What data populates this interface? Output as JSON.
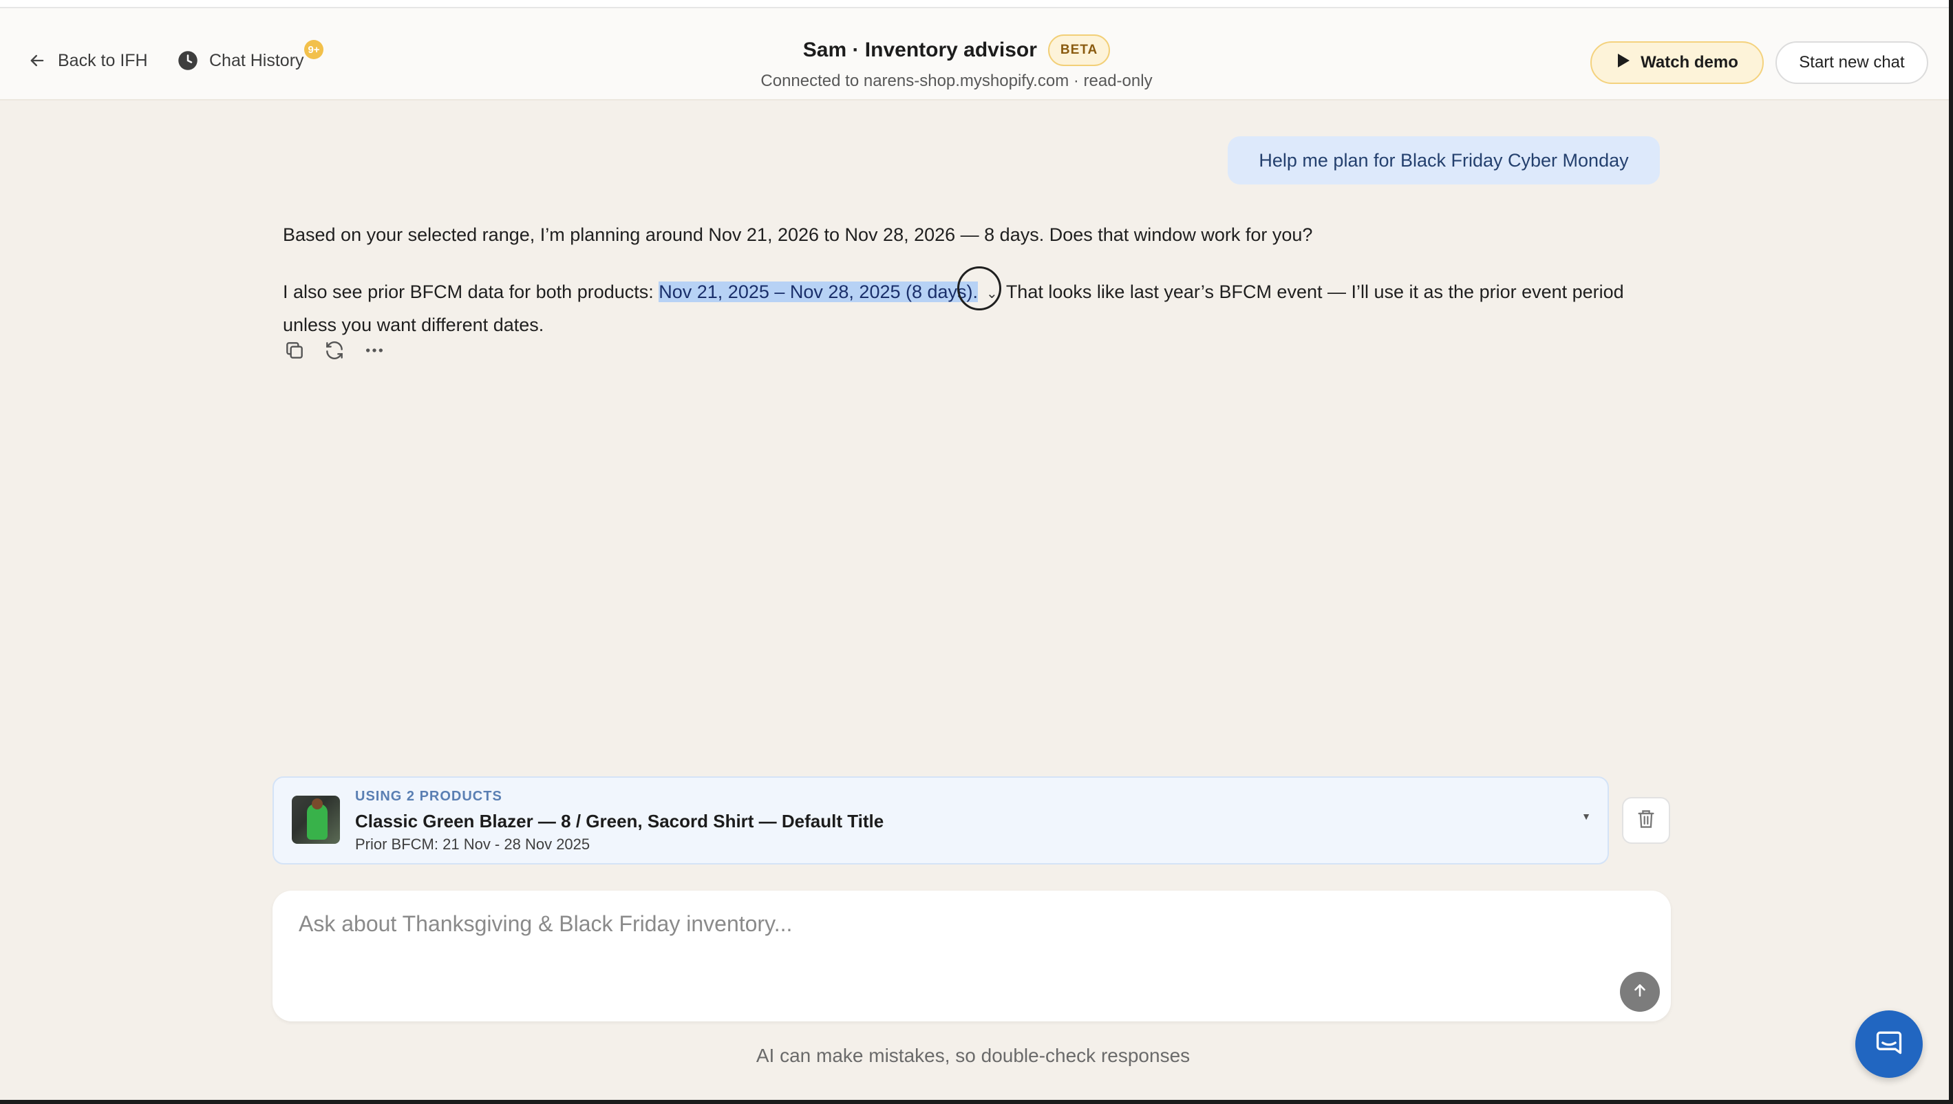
{
  "header": {
    "back_label": "Back to IFH",
    "history_label": "Chat History",
    "history_badge": "9+",
    "title": "Sam · Inventory advisor",
    "beta_label": "BETA",
    "subtitle": "Connected to narens-shop.myshopify.com · read-only",
    "watch_demo_label": "Watch demo",
    "start_new_chat_label": "Start new chat"
  },
  "conversation": {
    "user_message": "Help me plan for Black Friday Cyber Monday",
    "assistant_para1": "Based on your selected range, I’m planning around Nov 21, 2026 to Nov 28, 2026 — 8 days. Does that window work for you?",
    "assistant_para2_prefix": "I also see prior BFCM data for both products: ",
    "assistant_para2_highlight": "Nov 21, 2025 – Nov 28, 2025 (8 days).",
    "assistant_para2_suffix": "That looks like last year’s BFCM event — I’ll use it as the prior event period unless you want different dates."
  },
  "products_panel": {
    "label": "USING 2 PRODUCTS",
    "name": "Classic Green Blazer — 8 / Green, Sacord Shirt — Default Title",
    "subtitle": "Prior BFCM: 21 Nov - 28 Nov 2025"
  },
  "composer": {
    "placeholder": "Ask about Thanksgiving & Black Friday inventory...",
    "value": ""
  },
  "disclaimer": "AI can make mistakes, so double-check responses",
  "icons": {
    "back": "arrow-left-icon",
    "history": "clock-icon",
    "demo": "play-icon",
    "copy": "copy-icon",
    "regenerate": "refresh-icon",
    "more": "more-horizontal-icon",
    "delete": "trash-icon",
    "send": "arrow-up-icon",
    "chat": "chat-bubble-icon"
  },
  "colors": {
    "accent_blue": "#2166c1",
    "highlight": "#b7d2f5",
    "beta_badge": "#fdf3d9"
  }
}
